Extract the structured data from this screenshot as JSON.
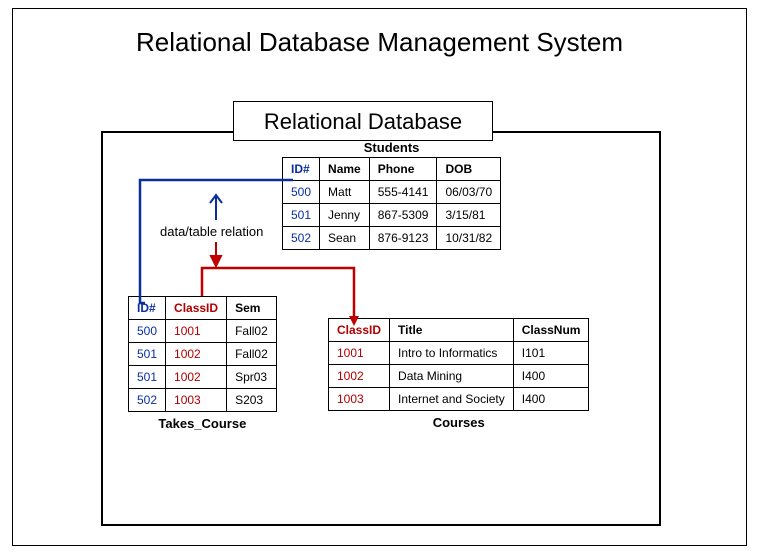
{
  "title": "Relational Database Management System",
  "subtitle": "Relational Database",
  "relation_label": "data/table relation",
  "students": {
    "name": "Students",
    "headers": {
      "id": "ID#",
      "name": "Name",
      "phone": "Phone",
      "dob": "DOB"
    },
    "rows": [
      {
        "id": "500",
        "name": "Matt",
        "phone": "555-4141",
        "dob": "06/03/70"
      },
      {
        "id": "501",
        "name": "Jenny",
        "phone": "867-5309",
        "dob": "3/15/81"
      },
      {
        "id": "502",
        "name": "Sean",
        "phone": "876-9123",
        "dob": "10/31/82"
      }
    ]
  },
  "takes": {
    "name": "Takes_Course",
    "headers": {
      "id": "ID#",
      "classid": "ClassID",
      "sem": "Sem"
    },
    "rows": [
      {
        "id": "500",
        "classid": "1001",
        "sem": "Fall02"
      },
      {
        "id": "501",
        "classid": "1002",
        "sem": "Fall02"
      },
      {
        "id": "501",
        "classid": "1002",
        "sem": "Spr03"
      },
      {
        "id": "502",
        "classid": "1003",
        "sem": "S203"
      }
    ]
  },
  "courses": {
    "name": "Courses",
    "headers": {
      "classid": "ClassID",
      "title": "Title",
      "classnum": "ClassNum"
    },
    "rows": [
      {
        "classid": "1001",
        "title": "Intro to Informatics",
        "classnum": "I101"
      },
      {
        "classid": "1002",
        "title": "Data Mining",
        "classnum": "I400"
      },
      {
        "classid": "1003",
        "title": "Internet and Society",
        "classnum": "I400"
      }
    ]
  }
}
